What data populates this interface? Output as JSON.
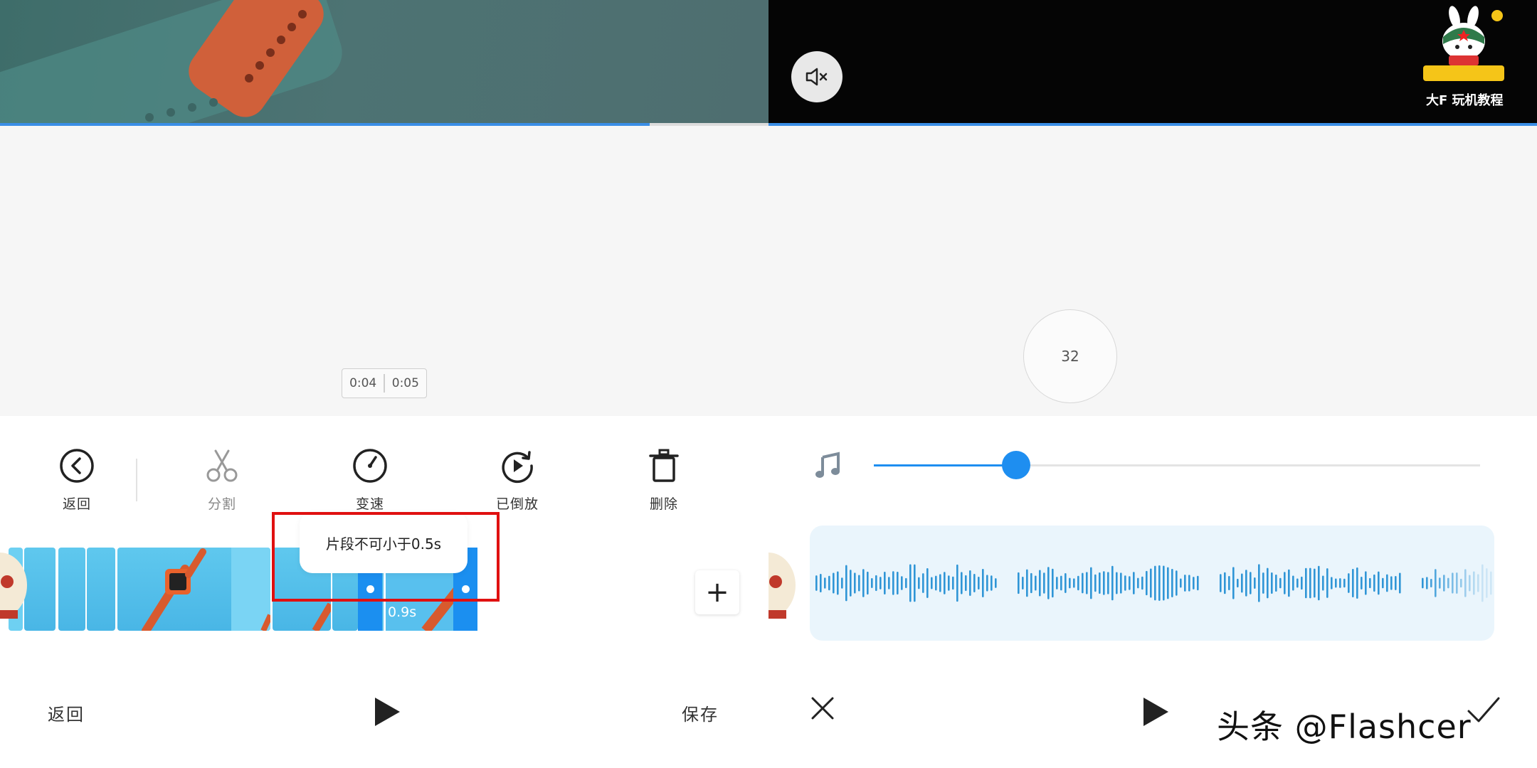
{
  "left_panel": {
    "playback_progress": 0.845,
    "time_display": {
      "current": "0:04",
      "total": "0:05"
    },
    "toolbar": {
      "back_label": "返回",
      "split_label": "分割",
      "speed_label": "变速",
      "reversed_label": "已倒放",
      "delete_label": "删除"
    },
    "timeline": {
      "selected_duration": "0.9s",
      "toast_message": "片段不可小于0.5s"
    },
    "add_button": "+",
    "bottom_bar": {
      "back_label": "返回",
      "save_label": "保存"
    },
    "icons": [
      "back-icon",
      "scissors-icon",
      "speed-gauge-icon",
      "reverse-play-icon",
      "trash-icon",
      "play-icon"
    ]
  },
  "right_panel": {
    "logo_caption": "大F 玩机教程",
    "volume_value": "32",
    "volume_fraction": 0.235,
    "icons": [
      "mute-icon",
      "music-note-icon",
      "close-icon",
      "play-icon",
      "check-icon"
    ],
    "watermark": "头条 @Flashcer"
  },
  "colors": {
    "accent": "#1e8ef0",
    "toast_border": "#e01010",
    "clip": "#58c0ee"
  }
}
